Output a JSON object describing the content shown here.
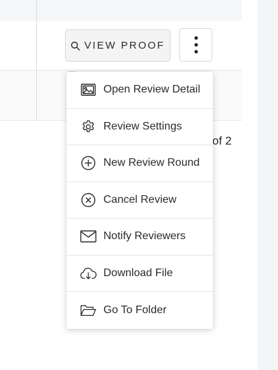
{
  "toolbar": {
    "view_proof_label": "VIEW PROOF",
    "view_proof_icon": "search-icon",
    "more_icon": "kebab-icon"
  },
  "pagination": {
    "text": "of 2"
  },
  "menu": {
    "items": [
      {
        "label": "Open Review Detail",
        "icon": "image-icon"
      },
      {
        "label": "Review Settings",
        "icon": "gear-icon"
      },
      {
        "label": "New Review Round",
        "icon": "plus-circle-icon"
      },
      {
        "label": "Cancel Review",
        "icon": "x-circle-icon"
      },
      {
        "label": "Notify Reviewers",
        "icon": "envelope-icon"
      },
      {
        "label": "Download File",
        "icon": "cloud-download-icon"
      },
      {
        "label": "Go To Folder",
        "icon": "folder-open-icon"
      }
    ]
  },
  "colors": {
    "text": "#2b2b2b",
    "border": "#d9d9d9",
    "button_bg": "#f4f4f4"
  }
}
